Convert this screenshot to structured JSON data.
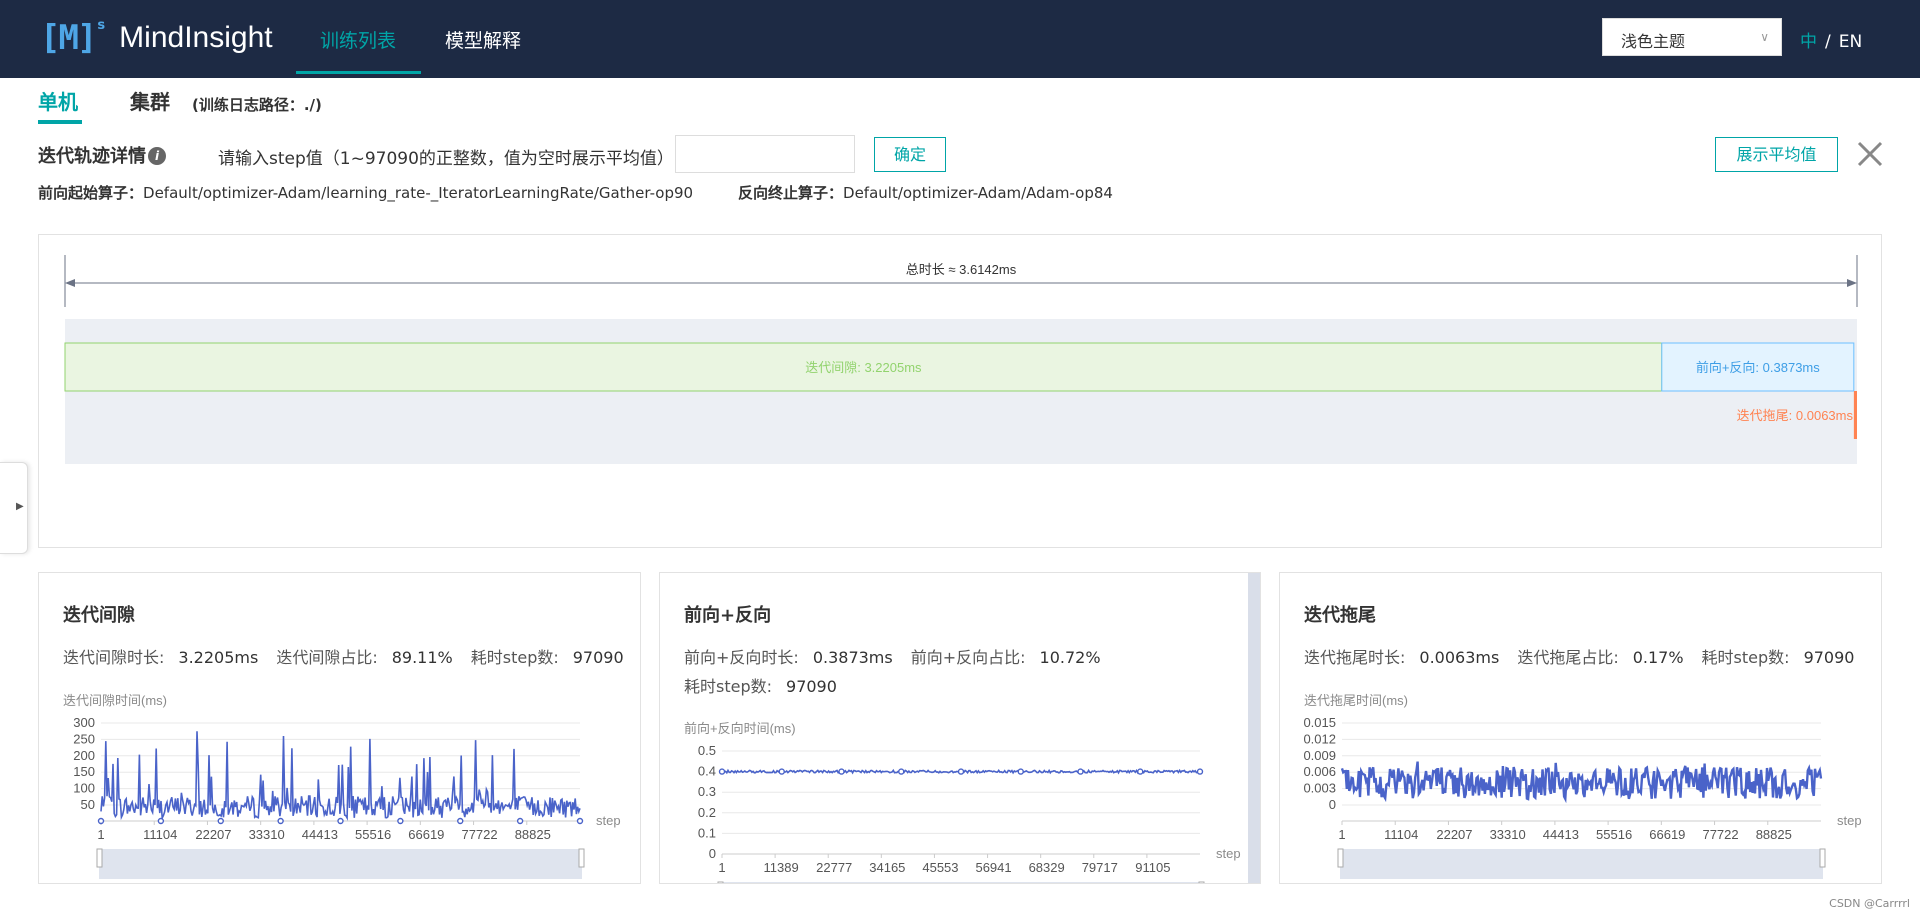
{
  "app": {
    "logo_mark": "[M]",
    "logo_sup": "s",
    "logo_text": "MindInsight"
  },
  "nav": {
    "items": [
      {
        "label": "训练列表",
        "active": true
      },
      {
        "label": "模型解释",
        "active": false
      }
    ]
  },
  "theme": {
    "selected": "浅色主题"
  },
  "lang": {
    "zh": "中",
    "sep": "/",
    "en": "EN"
  },
  "tabs": {
    "single": "单机",
    "cluster": "集群",
    "log_path": "(训练日志路径：./)"
  },
  "detail": {
    "title": "迭代轨迹详情",
    "step_prompt": "请输入step值（1~97090的正整数，值为空时展示平均值）",
    "step_value": "",
    "confirm_label": "确定",
    "show_avg_label": "展示平均值",
    "fp_start_label": "前向起始算子：",
    "fp_start_value": "Default/optimizer-Adam/learning_rate-_IteratorLearningRate/Gather-op90",
    "bp_end_label": "反向终止算子：",
    "bp_end_value": "Default/optimizer-Adam/Adam-op84"
  },
  "trace": {
    "total_label": "总时长 ≈ 3.6142ms",
    "total_ms": 3.6142,
    "segments": [
      {
        "label": "迭代间隙: 3.2205ms",
        "ms": 3.2205,
        "color": "#92d36e",
        "fill": "#eaf5e1"
      },
      {
        "label": "前向+反向: 0.3873ms",
        "ms": 0.3873,
        "color": "#6cbfff",
        "fill": "#e3f3ff"
      },
      {
        "label": "迭代拖尾: 0.0063ms",
        "ms": 0.0063,
        "color": "#ff8352",
        "fill": "#ff8352"
      }
    ]
  },
  "cards": [
    {
      "title": "迭代间隙",
      "stats_line1": [
        [
          "迭代间隙时长:",
          "3.2205ms"
        ],
        [
          "迭代间隙占比:",
          "89.11%"
        ],
        [
          "耗时step数:",
          "97090"
        ]
      ],
      "stats_line2": [],
      "chart_data": {
        "type": "line",
        "ylabel": "迭代间隙时间(ms)",
        "xlabel": "step",
        "yticks": [
          "300",
          "250",
          "200",
          "150",
          "100",
          "50"
        ],
        "xticks": [
          "1",
          "11104",
          "22207",
          "33310",
          "44413",
          "55516",
          "66619",
          "77722",
          "88825"
        ],
        "ylim": [
          0,
          300
        ]
      }
    },
    {
      "title": "前向+反向",
      "stats_line1": [
        [
          "前向+反向时长:",
          "0.3873ms"
        ],
        [
          "前向+反向占比:",
          "10.72%"
        ]
      ],
      "stats_line2": [
        [
          "耗时step数:",
          "97090"
        ]
      ],
      "chart_data": {
        "type": "line",
        "ylabel": "前向+反向时间(ms)",
        "xlabel": "step",
        "yticks": [
          "0.5",
          "0.4",
          "0.3",
          "0.2",
          "0.1",
          "0"
        ],
        "xticks": [
          "1",
          "11389",
          "22777",
          "34165",
          "45553",
          "56941",
          "68329",
          "79717",
          "91105"
        ],
        "ylim": [
          0,
          0.5
        ]
      }
    },
    {
      "title": "迭代拖尾",
      "stats_line1": [
        [
          "迭代拖尾时长:",
          "0.0063ms"
        ],
        [
          "迭代拖尾占比:",
          "0.17%"
        ],
        [
          "耗时step数:",
          "97090"
        ]
      ],
      "stats_line2": [],
      "chart_data": {
        "type": "line",
        "ylabel": "迭代拖尾时间(ms)",
        "xlabel": "step",
        "yticks": [
          "0.015",
          "0.012",
          "0.009",
          "0.006",
          "0.003",
          "0"
        ],
        "xticks": [
          "1",
          "11104",
          "22207",
          "33310",
          "44413",
          "55516",
          "66619",
          "77722",
          "88825"
        ],
        "ylim": [
          0,
          0.015
        ]
      }
    }
  ],
  "footer": {
    "note": "CSDN @Carrrrl"
  },
  "colors": {
    "accent": "#00a5a7",
    "header": "#1d2a44",
    "series": "#4a63c9"
  }
}
